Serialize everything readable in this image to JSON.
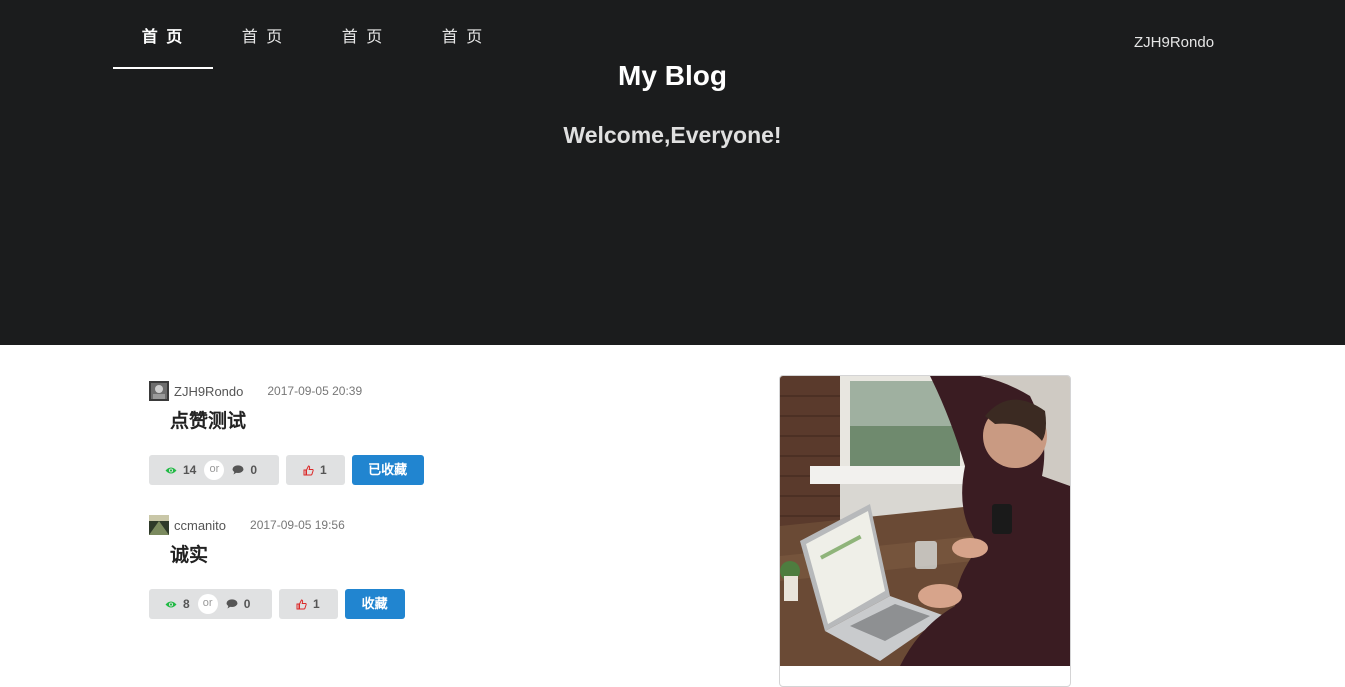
{
  "nav": {
    "items": [
      {
        "label": "首 页",
        "active": true
      },
      {
        "label": "首 页",
        "active": false
      },
      {
        "label": "首 页",
        "active": false
      },
      {
        "label": "首 页",
        "active": false
      }
    ],
    "user": "ZJH9Rondo"
  },
  "hero": {
    "title": "My Blog",
    "subtitle": "Welcome,Everyone!"
  },
  "posts": [
    {
      "author": "ZJH9Rondo",
      "date": "2017-09-05 20:39",
      "title": "点赞测试",
      "views": "14",
      "or": "or",
      "comments": "0",
      "likes": "1",
      "favorite_label": "已收藏"
    },
    {
      "author": "ccmanito",
      "date": "2017-09-05 19:56",
      "title": "诚实",
      "views": "8",
      "or": "or",
      "comments": "0",
      "likes": "1",
      "favorite_label": "收藏"
    }
  ],
  "colors": {
    "hero_bg": "#1b1c1d",
    "primary": "#2185d0",
    "view_icon": "#21ba45",
    "like_icon": "#db2828"
  },
  "icons": {
    "views": "eye-icon",
    "comments": "comment-icon",
    "likes": "thumbs-up-icon"
  }
}
